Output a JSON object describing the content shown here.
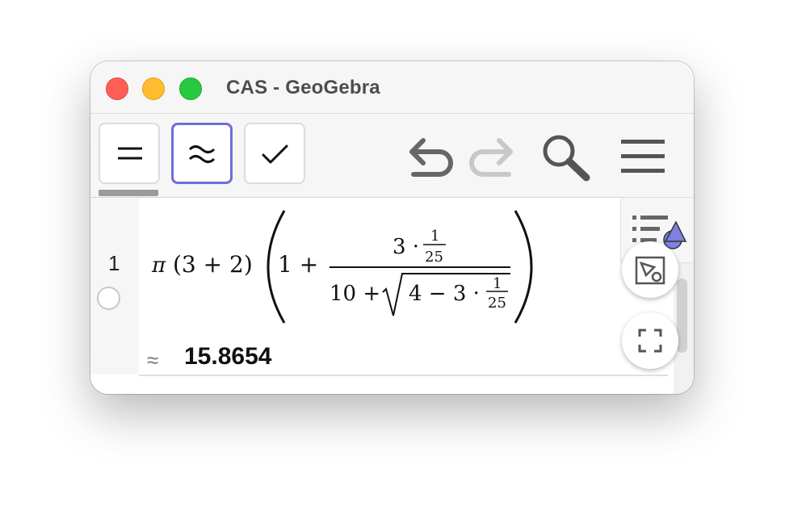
{
  "window": {
    "title": "CAS - GeoGebra"
  },
  "toolbar": {
    "buttons": [
      {
        "name": "evaluate",
        "symbol": "="
      },
      {
        "name": "numeric",
        "symbol": "≈",
        "selected": true
      },
      {
        "name": "keep-input",
        "symbol": "✓"
      }
    ],
    "icons": [
      "undo-icon",
      "redo-icon",
      "search-icon",
      "menu-icon"
    ]
  },
  "cas": {
    "rows": [
      {
        "number": "1",
        "input": {
          "pi": "π",
          "paren_sum": "(3 + 2)",
          "one_plus": "1 +",
          "numerator": "3 ·",
          "frac_num": "1",
          "frac_den": "25",
          "denominator_prefix": "10 +",
          "sqrt_content": "4 − 3 ·",
          "frac2_num": "1",
          "frac2_den": "25"
        },
        "output_symbol": "≈",
        "output": "15.8654"
      }
    ]
  },
  "colors": {
    "accent": "#6e6edb",
    "titlebar": "#f6f6f6",
    "close": "#ff5f57",
    "minimize": "#febc2e",
    "zoom": "#28c840"
  }
}
